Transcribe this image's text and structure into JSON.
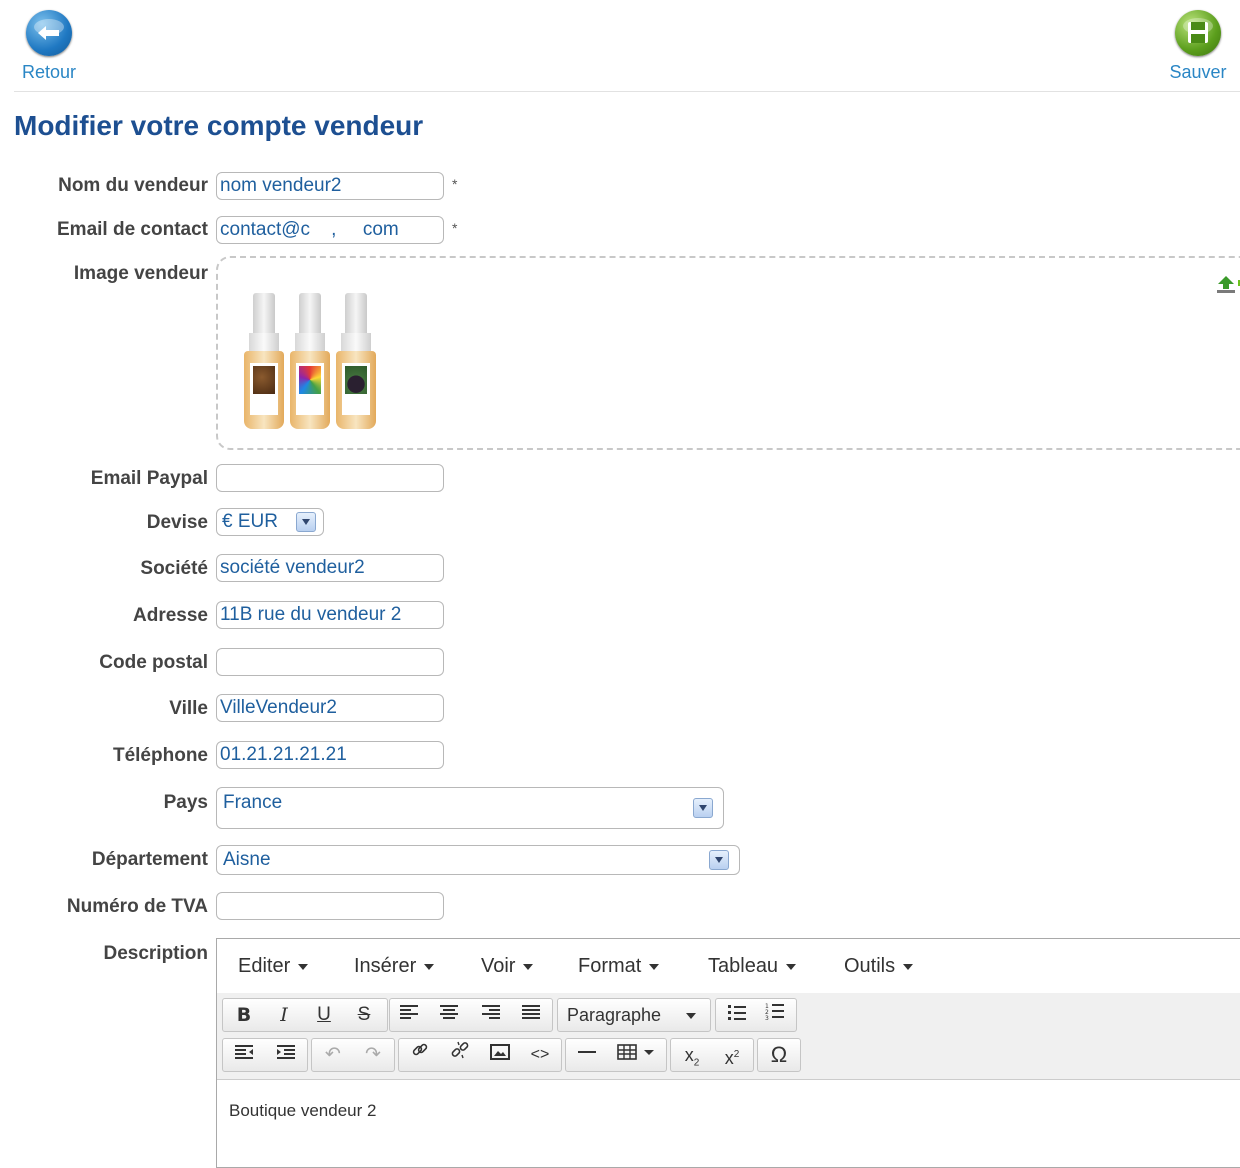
{
  "toolbar": {
    "back_label": "Retour",
    "save_label": "Sauver"
  },
  "page_title": "Modifier votre compte vendeur",
  "form": {
    "nom_label": "Nom du vendeur",
    "nom_value": "nom vendeur2",
    "email_label": "Email de contact",
    "email_value": "contact@c    ,     com",
    "required_mark": "*",
    "image_label": "Image vendeur",
    "paypal_label": "Email Paypal",
    "paypal_value": "",
    "devise_label": "Devise",
    "devise_value": "€ EUR",
    "societe_label": "Société",
    "societe_value": "société vendeur2",
    "adresse_label": "Adresse",
    "adresse_value": "11B rue du vendeur 2",
    "cp_label": "Code postal",
    "cp_value": "",
    "ville_label": "Ville",
    "ville_value": "VilleVendeur2",
    "tel_label": "Téléphone",
    "tel_value": "01.21.21.21.21",
    "pays_label": "Pays",
    "pays_value": "France",
    "dept_label": "Département",
    "dept_value": "Aisne",
    "tva_label": "Numéro de TVA",
    "tva_value": "",
    "description_label": "Description"
  },
  "editor": {
    "menus": [
      "Editer",
      "Insérer",
      "Voir",
      "Format",
      "Tableau",
      "Outils"
    ],
    "format_select": "Paragraphe",
    "content": "Boutique vendeur 2"
  },
  "icons": {
    "back": "arrow-left-circle-icon",
    "save": "floppy-disk-icon",
    "upload": "upload-add-icon"
  },
  "colors": {
    "title": "#1d4f91",
    "link": "#2a86c5",
    "input_text": "#1f5f9e"
  }
}
